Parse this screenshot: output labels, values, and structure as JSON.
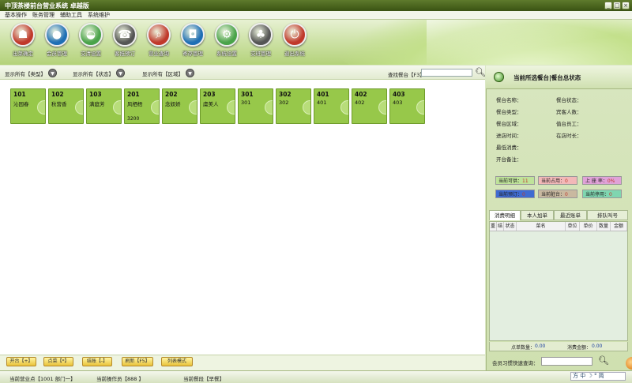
{
  "window": {
    "title": "中顶茶楼前台营业系统 卓越版"
  },
  "menu": [
    "基本操作",
    "账务管理",
    "辅助工具",
    "系统维护"
  ],
  "toolbar": [
    {
      "label": "出菜确定",
      "icon": "dish-cover-icon",
      "color": "#c0392b"
    },
    {
      "label": "会员管理",
      "icon": "user-icon",
      "color": "#1f6fb5"
    },
    {
      "label": "交清设置",
      "icon": "plate-icon",
      "color": "#4aa34a"
    },
    {
      "label": "客抵预订",
      "icon": "telephone-icon",
      "color": "#555555"
    },
    {
      "label": "营业查询",
      "icon": "magnifier-icon",
      "color": "#c0392b"
    },
    {
      "label": "寄存管理",
      "icon": "shopping-bag-icon",
      "color": "#1f6fb5"
    },
    {
      "label": "系统设置",
      "icon": "gear-icon",
      "color": "#4aa34a"
    },
    {
      "label": "交班管理",
      "icon": "people-icon",
      "color": "#555555"
    },
    {
      "label": "退出系统",
      "icon": "power-icon",
      "color": "#c0392b"
    }
  ],
  "filters": {
    "type": "显示所有【类型】",
    "status": "显示所有【状态】",
    "area": "显示所有【区域】",
    "search_label": "查找餐台【F3】"
  },
  "tables": [
    {
      "no": "101",
      "name": "沁园春",
      "extra": ""
    },
    {
      "no": "102",
      "name": "秋营香",
      "extra": ""
    },
    {
      "no": "103",
      "name": "满庭芳",
      "extra": ""
    },
    {
      "no": "201",
      "name": "风栖梧",
      "extra": "3200"
    },
    {
      "no": "202",
      "name": "念奴娇",
      "extra": ""
    },
    {
      "no": "203",
      "name": "虞美人",
      "extra": ""
    },
    {
      "no": "301",
      "name": "301",
      "extra": ""
    },
    {
      "no": "302",
      "name": "302",
      "extra": ""
    },
    {
      "no": "401",
      "name": "401",
      "extra": ""
    },
    {
      "no": "402",
      "name": "402",
      "extra": ""
    },
    {
      "no": "403",
      "name": "403",
      "extra": ""
    }
  ],
  "actions": [
    "开台【+】",
    "点菜【*】",
    "结账【-】",
    "刷新【F5】",
    "列表模式"
  ],
  "right": {
    "title": "当前所选餐台|餐台总状态",
    "fields_left": [
      "餐台名称：",
      "餐台类型：",
      "餐台区域：",
      "进店时间：",
      "最低消费：",
      "开台备注："
    ],
    "fields_right": [
      "餐台状态：",
      "宾客人数：",
      "值台员工：",
      "在店时长："
    ],
    "chips": [
      {
        "label": "当前可供：",
        "value": "11",
        "bg": "#bfe39a"
      },
      {
        "label": "当前占用：",
        "value": "0",
        "bg": "#f2b8b8"
      },
      {
        "label": "上 座 率：",
        "value": "0%",
        "bg": "#e0a2d8"
      },
      {
        "label": "当前预订：",
        "value": "0",
        "bg": "#3f6bd1"
      },
      {
        "label": "当前脏台：",
        "value": "0",
        "bg": "#c9b9a0"
      },
      {
        "label": "当前停用：",
        "value": "0",
        "bg": "#7fd6b0"
      }
    ],
    "tabs": [
      "消费明细",
      "本人加单",
      "最近账单",
      "排队叫号"
    ],
    "grid_headers": [
      "重",
      "结",
      "状态",
      "菜名",
      "单位",
      "单价",
      "数量",
      "金额"
    ],
    "footer": {
      "count_label": "点单数量：",
      "count": "0.00",
      "amount_label": "消费金额：",
      "amount": "0.00"
    },
    "vip_label": "会员习惯快速查询："
  },
  "status": {
    "point": "当前营业点【1001 部门一】",
    "operator": "当前操作员【888 】",
    "period": "当前餐段【早餐】"
  },
  "ime": "方 中 ☽ ° 简"
}
